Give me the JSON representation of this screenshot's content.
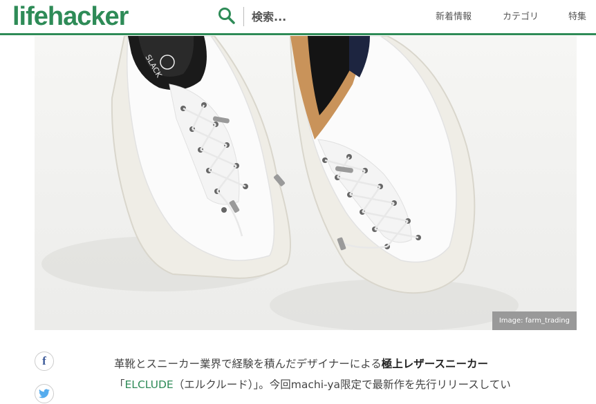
{
  "header": {
    "logo": "lifehacker",
    "search_placeholder": "検索...",
    "nav": [
      "新着情報",
      "カテゴリ",
      "特集"
    ]
  },
  "hero": {
    "credit": "Image: farm_trading",
    "shoe_brand_mark": "SLACK"
  },
  "article": {
    "line1_text": "革靴とスニーカー業界で経験を積んだデザイナーによる",
    "line1_bold": "極上レザースニーカー",
    "line2_open": "「",
    "line2_link": "ELCLUDE",
    "line2_text": "（エルクルード）」。今回machi-ya限定で最新作を先行リリースしてい"
  },
  "colors": {
    "brand": "#2e8b57",
    "facebook": "#3b5998",
    "twitter": "#55acee"
  }
}
